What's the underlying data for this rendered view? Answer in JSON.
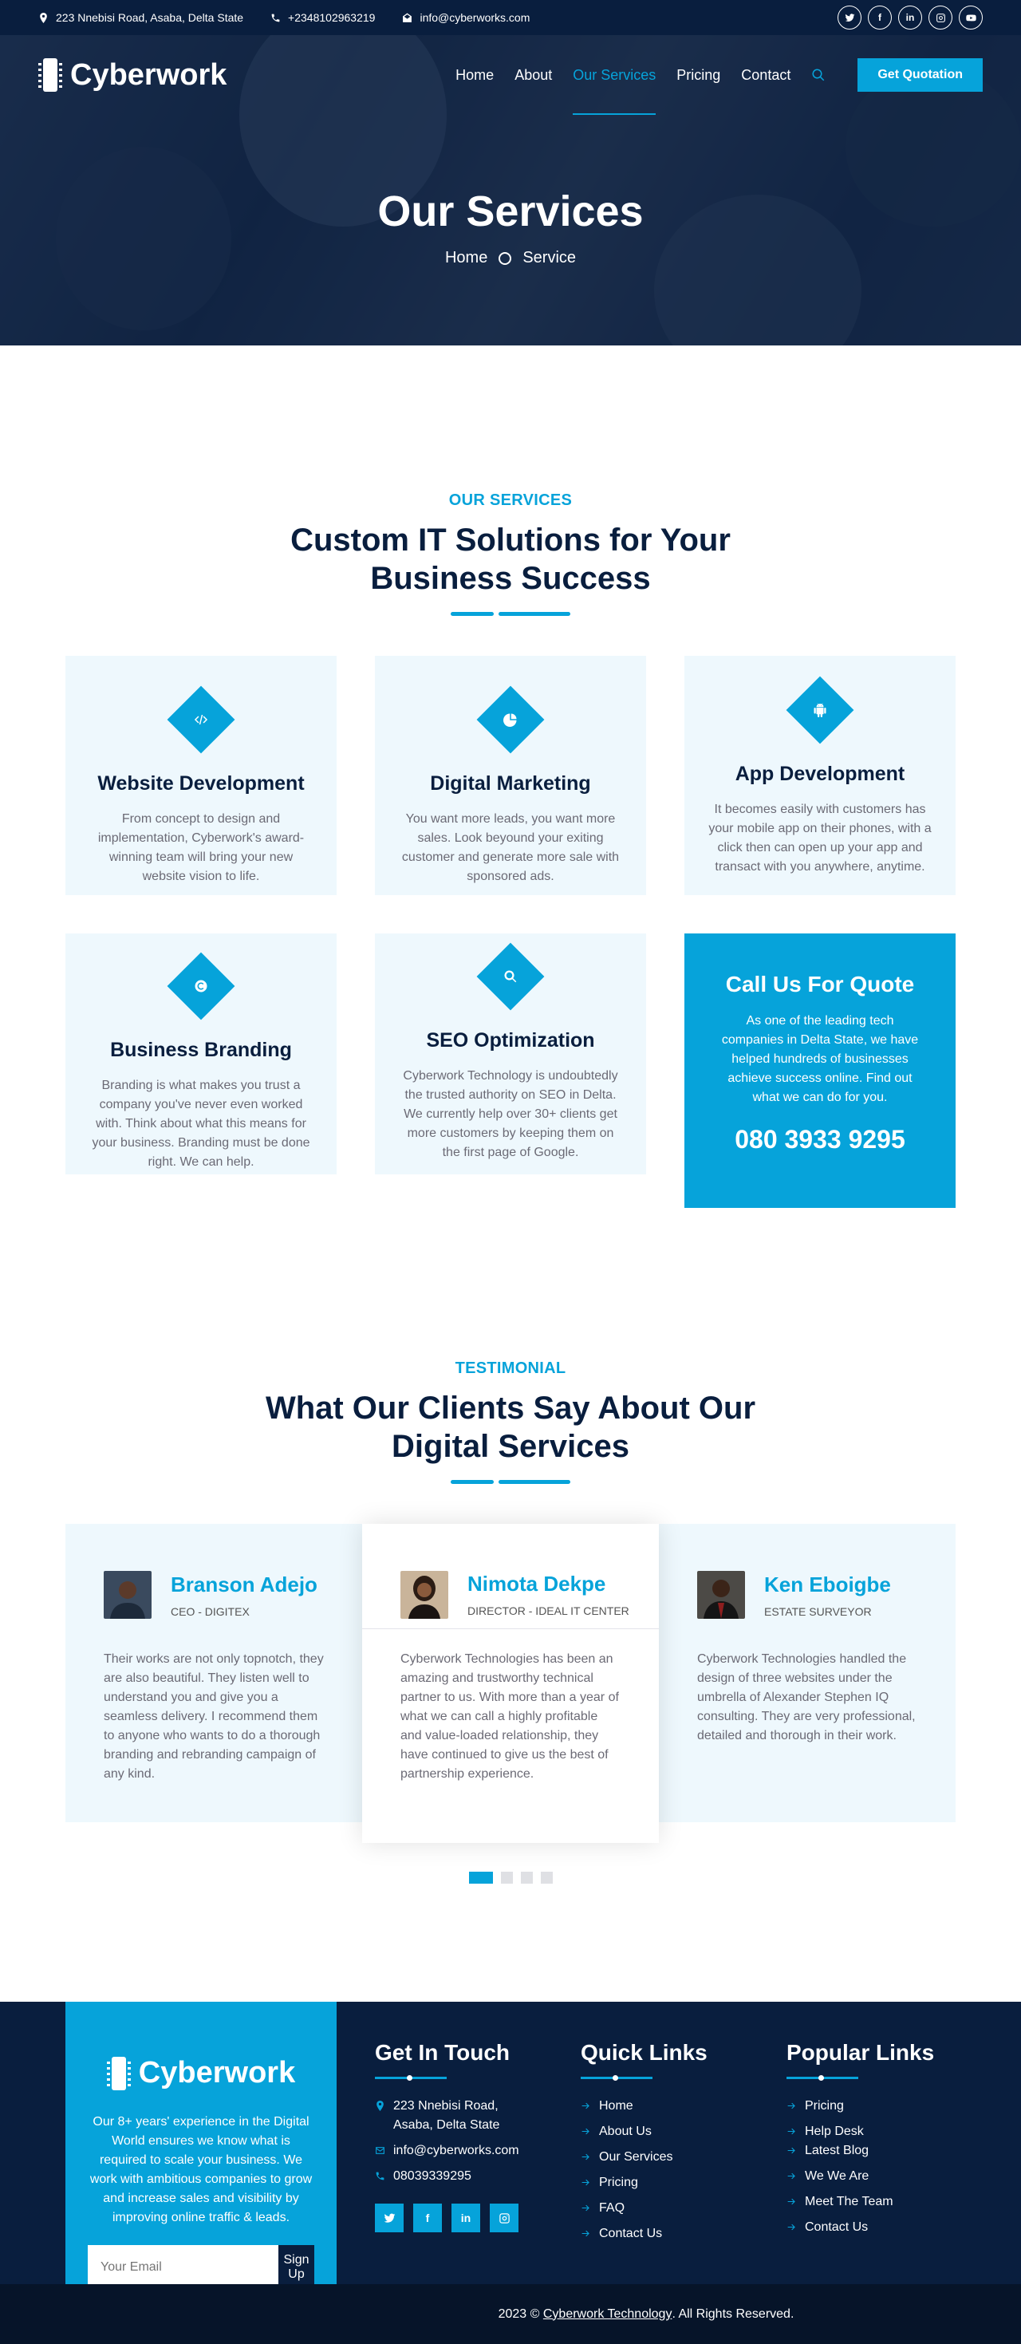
{
  "topbar": {
    "address": "223 Nnebisi Road, Asaba, Delta State",
    "phone": "+2348102963219",
    "email": "info@cyberworks.com"
  },
  "brand": {
    "name": "Cyberwork"
  },
  "nav": {
    "items": [
      {
        "label": "Home"
      },
      {
        "label": "About"
      },
      {
        "label": "Our Services",
        "active": true
      },
      {
        "label": "Pricing"
      },
      {
        "label": "Contact"
      }
    ],
    "cta": "Get Quotation"
  },
  "hero": {
    "title": "Our Services",
    "crumb_home": "Home",
    "crumb_current": "Service"
  },
  "services": {
    "sub": "OUR SERVICES",
    "title": "Custom IT Solutions for Your Business Success",
    "cards": [
      {
        "icon": "code-icon",
        "title": "Website Development",
        "text": "From concept to design and implementation, Cyberwork's award-winning team will bring your new website vision to life."
      },
      {
        "icon": "chart-pie-icon",
        "title": "Digital Marketing",
        "text": "You want more leads, you want more sales. Look beyound your exiting customer and generate more sale with sponsored ads."
      },
      {
        "icon": "android-icon",
        "title": "App Development",
        "text": "It becomes easily with customers has your mobile app on their phones, with a click then can open up your app and transact with you anywhere, anytime."
      },
      {
        "icon": "copyright-icon",
        "title": "Business Branding",
        "text": "Branding is what makes you trust a company you've never even worked with. Think about what this means for your business. Branding must be done right. We can help."
      },
      {
        "icon": "search-icon",
        "title": "SEO Optimization",
        "text": "Cyberwork Technology is undoubtedly the trusted authority on SEO in Delta. We currently help over 30+ clients get more customers by keeping them on the first page of Google."
      }
    ],
    "quote": {
      "title": "Call Us For Quote",
      "text": "As one of the leading tech companies in Delta State, we have helped hundreds of businesses achieve success online. Find out what we can do for you.",
      "phone": "080 3933 9295"
    }
  },
  "testimonials": {
    "sub": "TESTIMONIAL",
    "title": "What Our Clients Say About Our Digital Services",
    "items": [
      {
        "name": "Branson Adejo",
        "role": "CEO - DIGITEX",
        "text": "Their works are not only topnotch, they are also beautiful. They listen well to understand you and give you a seamless delivery. I recommend them to anyone who wants to do a thorough branding and rebranding campaign of any kind."
      },
      {
        "name": "Nimota Dekpe",
        "role": "DIRECTOR - IDEAL IT CENTER",
        "text": "Cyberwork Technologies has been an amazing and trustworthy technical partner to us. With more than a year of what we can call a highly profitable and value-loaded relationship, they have continued to give us the best of partnership experience."
      },
      {
        "name": "Ken Eboigbe",
        "role": "ESTATE SURVEYOR",
        "text": "Cyberwork Technologies handled the design of three websites under the umbrella of Alexander Stephen IQ consulting. They are very professional, detailed and thorough in their work."
      }
    ]
  },
  "footer": {
    "about": "Our 8+ years' experience in the Digital World ensures we know what is required to scale your business. We work with ambitious companies to grow and increase sales and visibility by improving online traffic & leads.",
    "email_placeholder": "Your Email",
    "signup": "Sign Up",
    "touch_title": "Get In Touch",
    "touch_address": "223 Nnebisi Road, Asaba, Delta State",
    "touch_email": "info@cyberworks.com",
    "touch_phone": "08039339295",
    "quick_title": "Quick Links",
    "quick_links": [
      "Home",
      "About Us",
      "Our Services",
      "Pricing",
      "FAQ",
      "Contact Us"
    ],
    "popular_title": "Popular Links",
    "popular_links": [
      "Pricing",
      "Help Desk",
      "Latest Blog",
      "We We Are",
      "Meet The Team",
      "Contact Us"
    ],
    "copy_pre": "2023 ©",
    "copy_link": "Cyberwork Technology",
    "copy_post": ". All Rights Reserved."
  },
  "colors": {
    "primary": "#06a3da",
    "dark": "#091e3e",
    "light": "#eef8fd"
  }
}
